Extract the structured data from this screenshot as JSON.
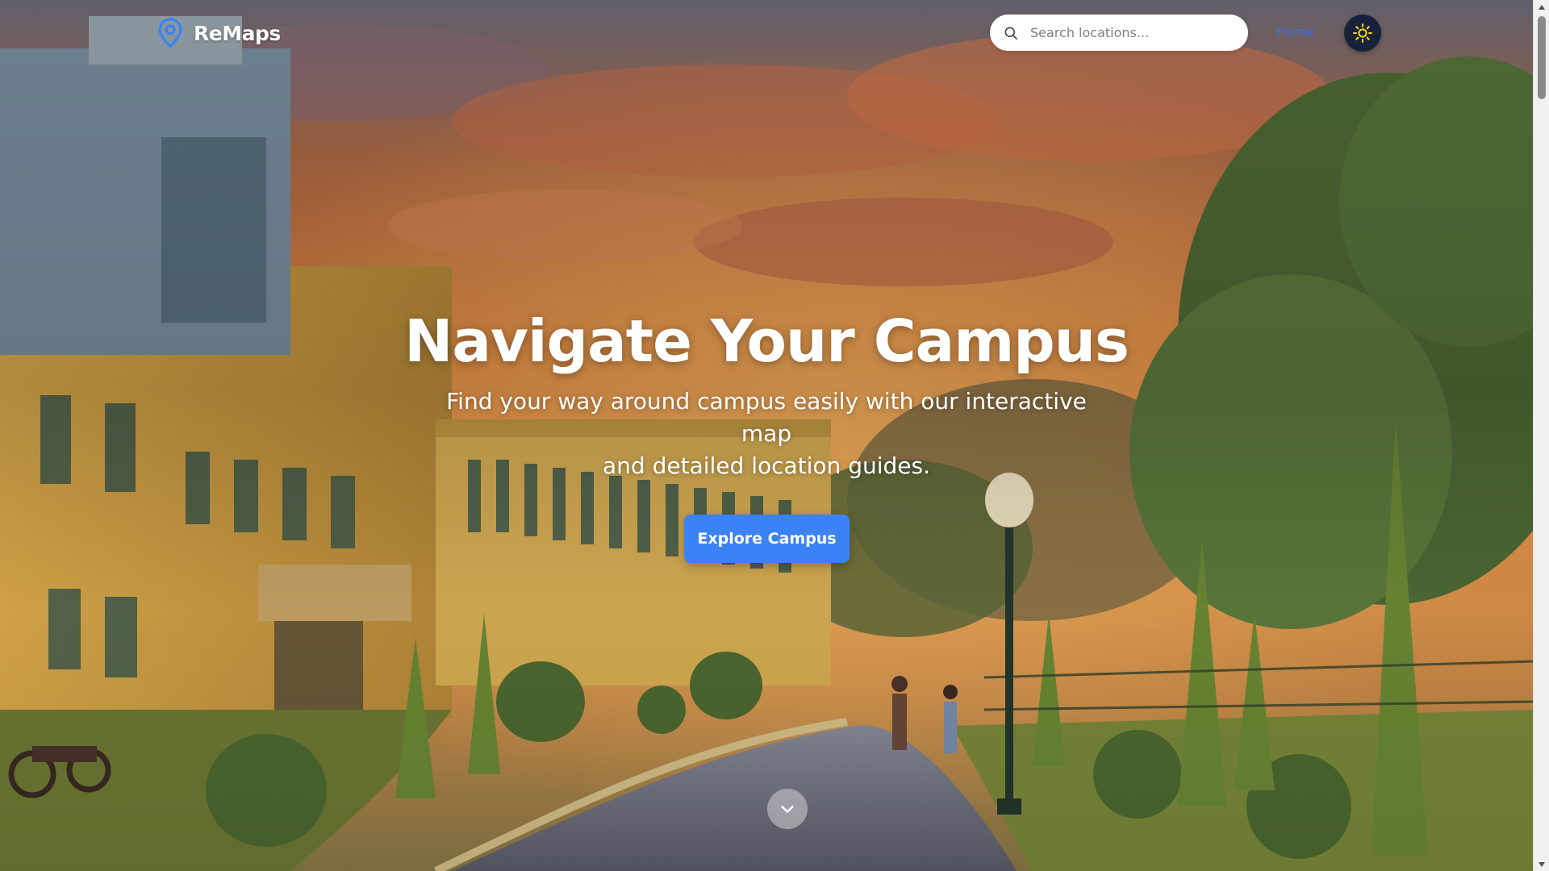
{
  "brand": {
    "name": "ReMaps",
    "icon": "map-pin-icon",
    "icon_color": "#3b82f6"
  },
  "search": {
    "placeholder": "Search locations...",
    "value": ""
  },
  "nav": {
    "home_label": "Home",
    "home_color": "#3b6fe0",
    "theme_icon": "sun-icon",
    "theme_icon_color": "#facc15"
  },
  "hero": {
    "title": "Navigate Your Campus",
    "subtitle_line1": "Find your way around campus easily with our interactive map",
    "subtitle_line2": "and detailed location guides.",
    "cta_label": "Explore Campus",
    "cta_color": "#3b82f6",
    "scroll_icon": "chevron-down-icon"
  },
  "background": {
    "description_icon": "campus-sunset-illustration"
  }
}
